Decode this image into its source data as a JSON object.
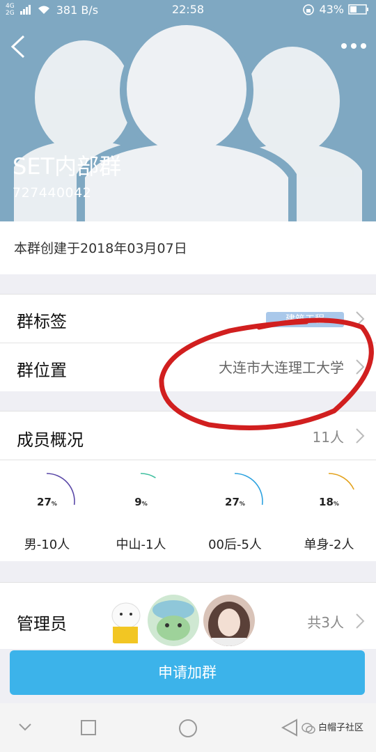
{
  "status_bar": {
    "signal_top": "4G",
    "signal_bottom": "2G",
    "net_speed": "381 B/s",
    "time": "22:58",
    "battery": "43%"
  },
  "group": {
    "name": "SET内部群",
    "id": "727440042",
    "created": "本群创建于2018年03月07日"
  },
  "tag_row": {
    "label": "群标签",
    "badge": "建筑工程"
  },
  "location_row": {
    "label": "群位置",
    "value": "大连市大连理工大学"
  },
  "members": {
    "label": "成员概况",
    "count": "11人",
    "stats": [
      {
        "value": 27,
        "unit": "%",
        "label": "男-10人",
        "color": "#5b49a8"
      },
      {
        "value": 9,
        "unit": "%",
        "label": "中山-1人",
        "color": "#3fbf9f"
      },
      {
        "value": 27,
        "unit": "%",
        "label": "00后-5人",
        "color": "#2fa3e0"
      },
      {
        "value": 18,
        "unit": "%",
        "label": "单身-2人",
        "color": "#e3a21c"
      }
    ]
  },
  "admins": {
    "label": "管理员",
    "count": "共3人"
  },
  "join_button": "申请加群",
  "watermark": "白帽子社区"
}
